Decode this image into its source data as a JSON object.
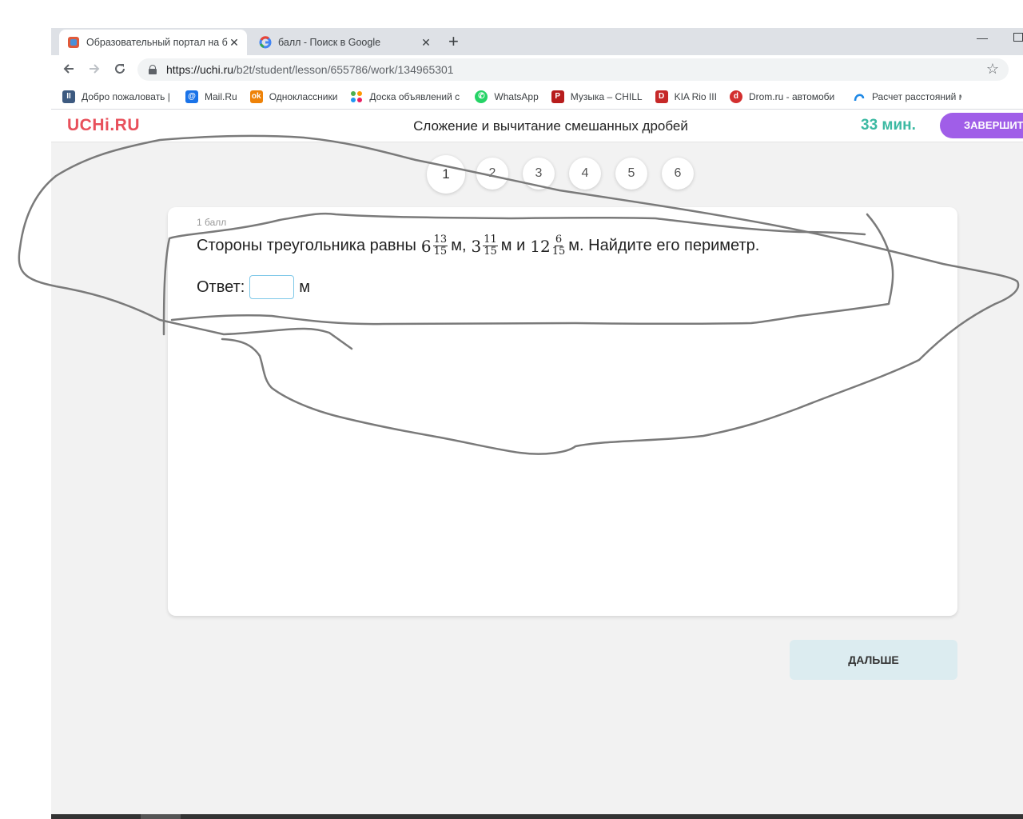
{
  "browser": {
    "tabs": [
      {
        "title": "Образовательный портал на ба",
        "close": "✕"
      },
      {
        "title": "балл - Поиск в Google",
        "close": "✕"
      }
    ],
    "new_tab": "+",
    "url_host": "https://uchi.ru",
    "url_path": "/b2t/student/lesson/655786/work/134965301",
    "bookmarks": [
      {
        "label": "Добро пожаловать |",
        "icon": "tile-icon",
        "color": "#3d5a80"
      },
      {
        "label": "Mail.Ru",
        "icon": "at-icon",
        "color": "#1a73e8"
      },
      {
        "label": "Одноклассники",
        "icon": "ok-icon",
        "color": "#ee8208"
      },
      {
        "label": "Доска объявлений с",
        "icon": "dots-icon",
        "color": "#e64a19"
      },
      {
        "label": "WhatsApp",
        "icon": "whatsapp-icon",
        "color": "#25d366"
      },
      {
        "label": "Музыка – CHILL",
        "icon": "p-icon",
        "color": "#b71c1c"
      },
      {
        "label": "KIA Rio III",
        "icon": "d-icon",
        "color": "#c62828"
      },
      {
        "label": "Drom.ru - автомоби",
        "icon": "drom-icon",
        "color": "#d32f2f"
      },
      {
        "label": "Расчет расстояний м",
        "icon": "route-icon",
        "color": "#1e88e5"
      }
    ]
  },
  "page": {
    "logo": "UCHi.RU",
    "lesson_title": "Сложение и вычитание смешанных дробей",
    "timer": "33 мин.",
    "finish_label": "ЗАВЕРШИТЬ",
    "steps": [
      "1",
      "2",
      "3",
      "4",
      "5",
      "6"
    ],
    "task": {
      "points": "1 балл",
      "text_before": "Стороны треугольника равны",
      "n1_whole": "6",
      "n1_num": "13",
      "n1_den": "15",
      "sep1": "м,",
      "n2_whole": "3",
      "n2_num": "11",
      "n2_den": "15",
      "sep2": "м и",
      "n3_whole": "12",
      "n3_num": "6",
      "n3_den": "15",
      "text_after": "м. Найдите его периметр.",
      "answer_label": "Ответ:",
      "answer_unit": "м"
    },
    "next_label": "ДАЛЬШЕ"
  },
  "colors": {
    "logo": "#e8505b",
    "timer": "#3bb9a2",
    "finish_button": "#a05ee8",
    "next_button": "#dcecf0",
    "scribble": "#7a7a7a"
  }
}
